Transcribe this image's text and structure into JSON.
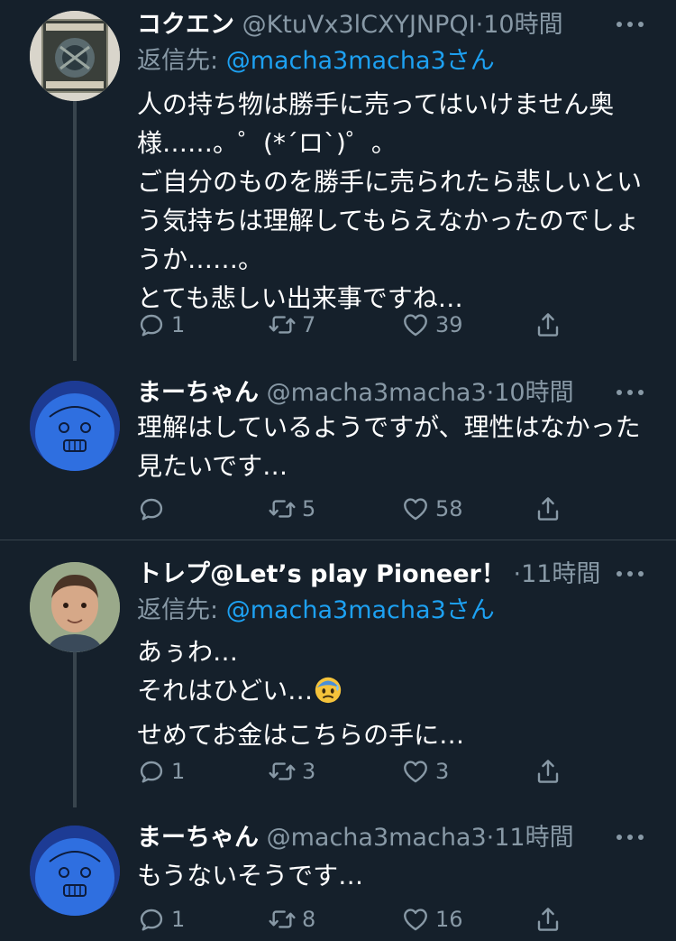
{
  "tweets": [
    {
      "name": "コクエン",
      "handle": "@KtuVx3lCXYJNPQI",
      "dot": "·",
      "time": "10時間",
      "reply_label": "返信先: ",
      "reply_mention": "@macha3macha3さん",
      "body": "人の持ち物は勝手に売ってはいけません奥\n様……。゜(*´ロ`)゜。\nご自分のものを勝手に売られたら悲しいとい\nう気持ちは理解してもらえなかったのでしょ\nうか……。\nとても悲しい出来事ですね…",
      "replies": "1",
      "retweets": "7",
      "likes": "39"
    },
    {
      "name": "まーちゃん",
      "handle": "@macha3macha3",
      "dot": "·",
      "time": "10時間",
      "body": "理解はしているようですが、理性はなかった\n見たいです…",
      "replies": "",
      "retweets": "5",
      "likes": "58"
    },
    {
      "name": "トレプ@Let’s play Pioneer！",
      "dot": "·",
      "time": "11時間",
      "reply_label": "返信先: ",
      "reply_mention": "@macha3macha3さん",
      "body_lines": [
        "あぅわ…",
        "それはひどい…",
        "せめてお金はこちらの手に…"
      ],
      "emoji": "anxious-face-with-sweat",
      "replies": "1",
      "retweets": "3",
      "likes": "3"
    },
    {
      "name": "まーちゃん",
      "handle": "@macha3macha3",
      "dot": "·",
      "time": "11時間",
      "body": "もうないそうです…",
      "replies": "1",
      "retweets": "8",
      "likes": "16"
    }
  ],
  "colors": {
    "background": "#15202b",
    "text": "#ffffff",
    "muted": "#8899a6",
    "link": "#1da1f2",
    "divider": "#38444d"
  },
  "icons": [
    "reply-icon",
    "retweet-icon",
    "like-icon",
    "share-icon",
    "more-icon"
  ]
}
